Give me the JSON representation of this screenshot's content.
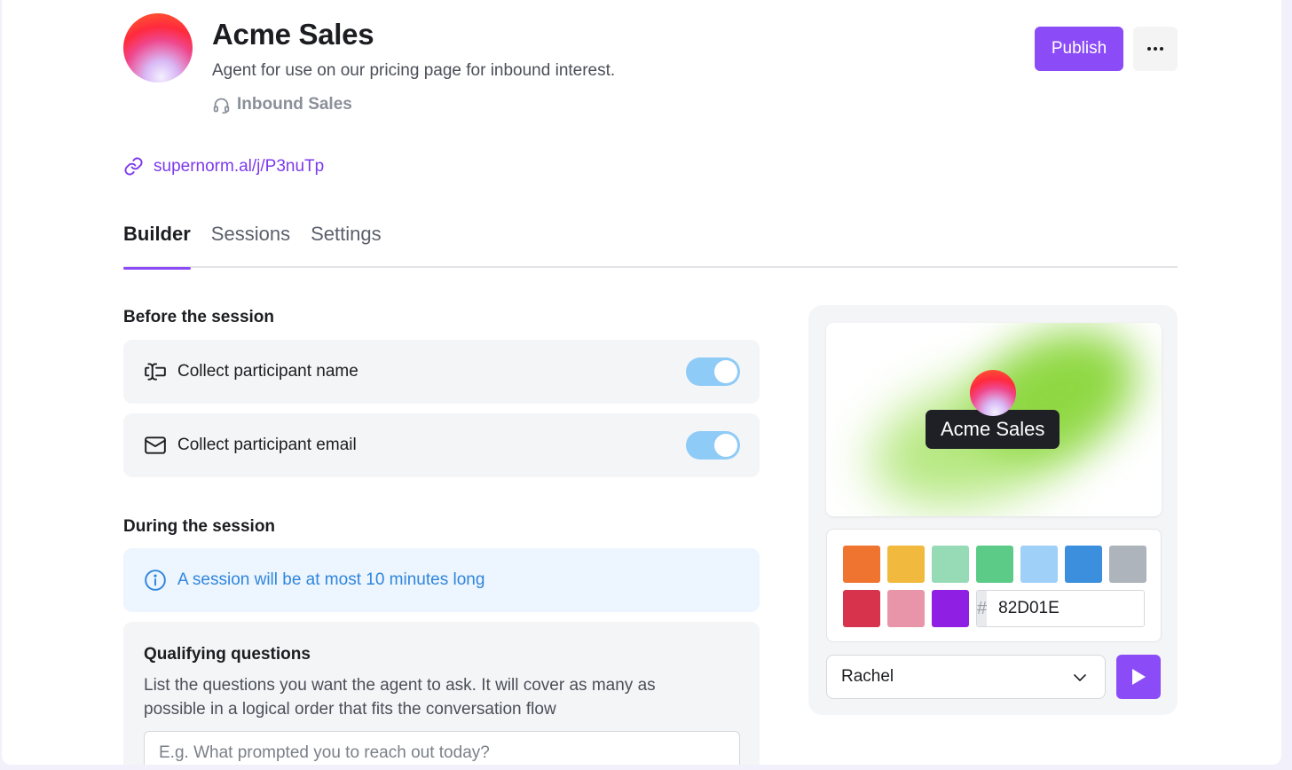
{
  "header": {
    "title": "Acme Sales",
    "description": "Agent for use on our pricing page for inbound interest.",
    "tag": "Inbound Sales",
    "link": "supernorm.al/j/P3nuTp",
    "publish_label": "Publish"
  },
  "tabs": [
    {
      "label": "Builder",
      "active": true
    },
    {
      "label": "Sessions",
      "active": false
    },
    {
      "label": "Settings",
      "active": false
    }
  ],
  "before_session": {
    "heading": "Before the session",
    "items": [
      {
        "label": "Collect participant name",
        "enabled": true
      },
      {
        "label": "Collect participant email",
        "enabled": true
      }
    ]
  },
  "during_session": {
    "heading": "During the session",
    "info": "A session will be at most 10 minutes long"
  },
  "qualifying": {
    "title": "Qualifying questions",
    "description": "List the questions you want the agent to ask. It will cover as many as possible in a logical order that fits the conversation flow",
    "placeholder": "E.g. What prompted you to reach out today?"
  },
  "preview": {
    "name": "Acme Sales",
    "swatches": [
      "#ef7430",
      "#f1b93e",
      "#97dbb6",
      "#5ccb88",
      "#9ed0f8",
      "#3b8fdc",
      "#aeb4bb",
      "#d8334c",
      "#e995a9",
      "#8f1fe3"
    ],
    "hex_prefix": "#",
    "hex_value": "82D01E",
    "voice": "Rachel"
  },
  "colors": {
    "accent": "#8b4cf7",
    "toggle_on": "#8ecbf7",
    "info_text": "#2f86de",
    "info_bg": "#edf5fe"
  }
}
